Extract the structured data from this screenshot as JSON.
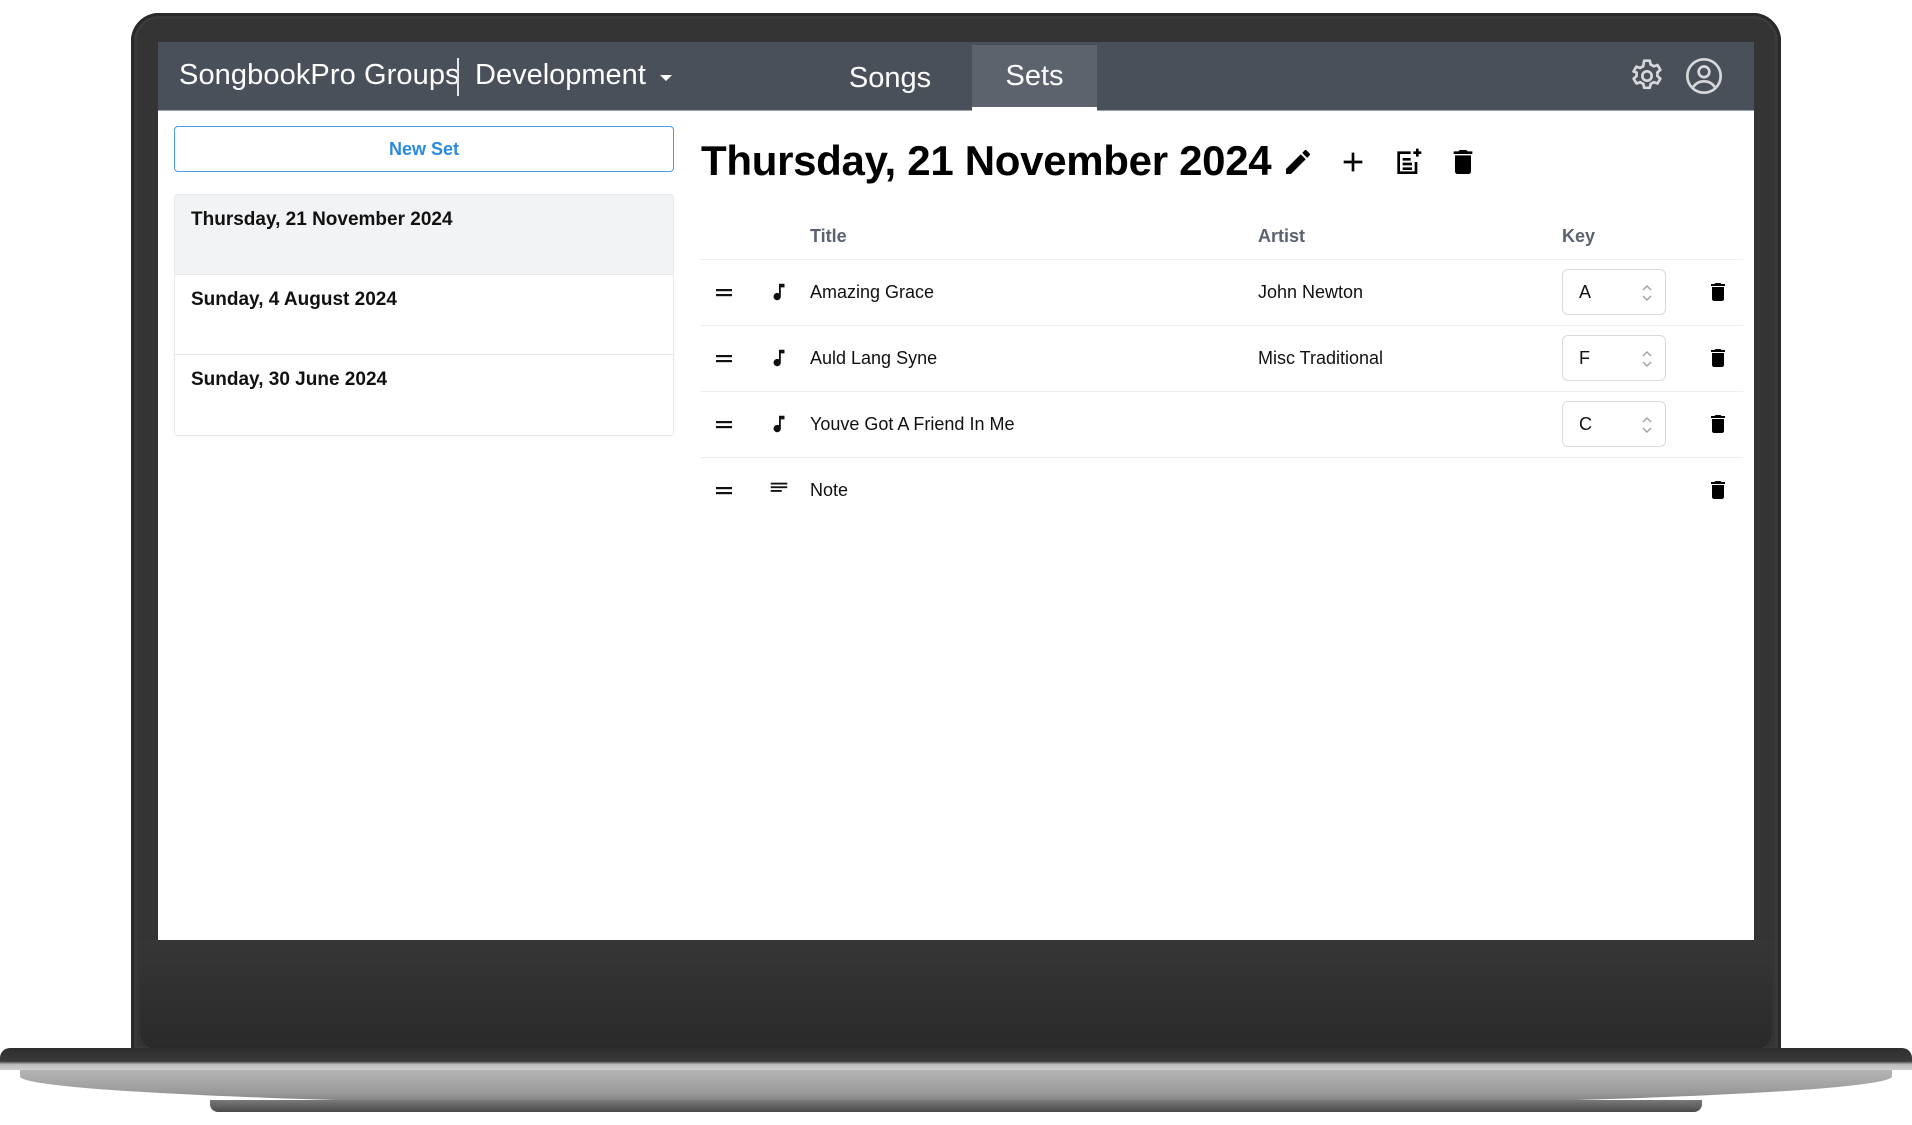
{
  "app": {
    "brand": "SongbookPro Groups",
    "group_selector": "Development"
  },
  "nav": {
    "tabs": [
      {
        "label": "Songs",
        "active": false
      },
      {
        "label": "Sets",
        "active": true
      }
    ],
    "icons": [
      "gear-icon",
      "user-circle-icon"
    ]
  },
  "sidebar": {
    "new_set_label": "New Set",
    "sets": [
      {
        "label": "Thursday, 21 November 2024",
        "active": true
      },
      {
        "label": "Sunday, 4 August 2024",
        "active": false
      },
      {
        "label": "Sunday, 30 June 2024",
        "active": false
      }
    ]
  },
  "main": {
    "set_title": "Thursday, 21 November 2024",
    "title_actions": [
      "pencil-icon",
      "plus-icon",
      "add-note-icon",
      "trash-icon"
    ],
    "columns": {
      "title": "Title",
      "artist": "Artist",
      "key": "Key"
    },
    "items": [
      {
        "type": "song",
        "title": "Amazing Grace",
        "artist": "John Newton",
        "key": "A"
      },
      {
        "type": "song",
        "title": "Auld Lang Syne",
        "artist": "Misc Traditional",
        "key": "F"
      },
      {
        "type": "song",
        "title": "Youve Got A Friend In Me",
        "artist": "",
        "key": "C"
      },
      {
        "type": "note",
        "title": "Note",
        "artist": "",
        "key": ""
      }
    ]
  },
  "colors": {
    "navbar": "#4a5059",
    "active_tab": "#5c636c",
    "accent": "#2b8ae0",
    "selected_item_bg": "#f2f3f5"
  }
}
